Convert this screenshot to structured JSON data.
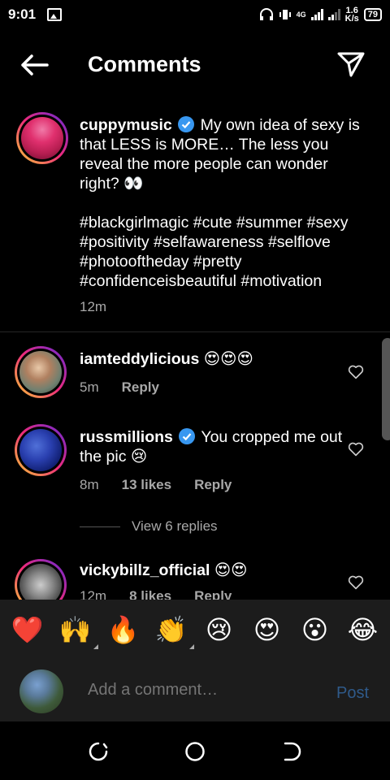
{
  "status_bar": {
    "time": "9:01",
    "network_label": "4G",
    "net_speed_value": "1.6",
    "net_speed_unit": "K/s",
    "battery": "79"
  },
  "header": {
    "title": "Comments"
  },
  "caption": {
    "username": "cuppymusic",
    "text": "My own idea of sexy is that LESS is MORE… The less you reveal the more people can wonder right? 👀",
    "hashtags": "#blackgirlmagic #cute #summer #sexy #positivity #selfawareness #selflove #photooftheday #pretty #confidenceisbeautiful #motivation",
    "time": "12m"
  },
  "comments": [
    {
      "username": "iamteddylicious",
      "text": "😍😍😍",
      "time": "5m",
      "likes": "",
      "reply_label": "Reply"
    },
    {
      "username": "russmillions",
      "text": "You cropped me out the pic 😢",
      "time": "8m",
      "likes": "13 likes",
      "reply_label": "Reply"
    },
    {
      "username": "vickybillz_official",
      "text": "😍😍",
      "time": "12m",
      "likes": "8 likes",
      "reply_label": "Reply"
    }
  ],
  "view_replies": "View 6 replies",
  "emoji_bar": [
    "❤️",
    "🙌",
    "🔥",
    "👏",
    "😢",
    "😍",
    "😮",
    "😂"
  ],
  "add_comment": {
    "placeholder": "Add a comment…",
    "post_label": "Post"
  },
  "colors": {
    "accent_blue": "#3897f0",
    "post_disabled": "#2f5a8a",
    "secondary_text": "#a8a8a8"
  }
}
